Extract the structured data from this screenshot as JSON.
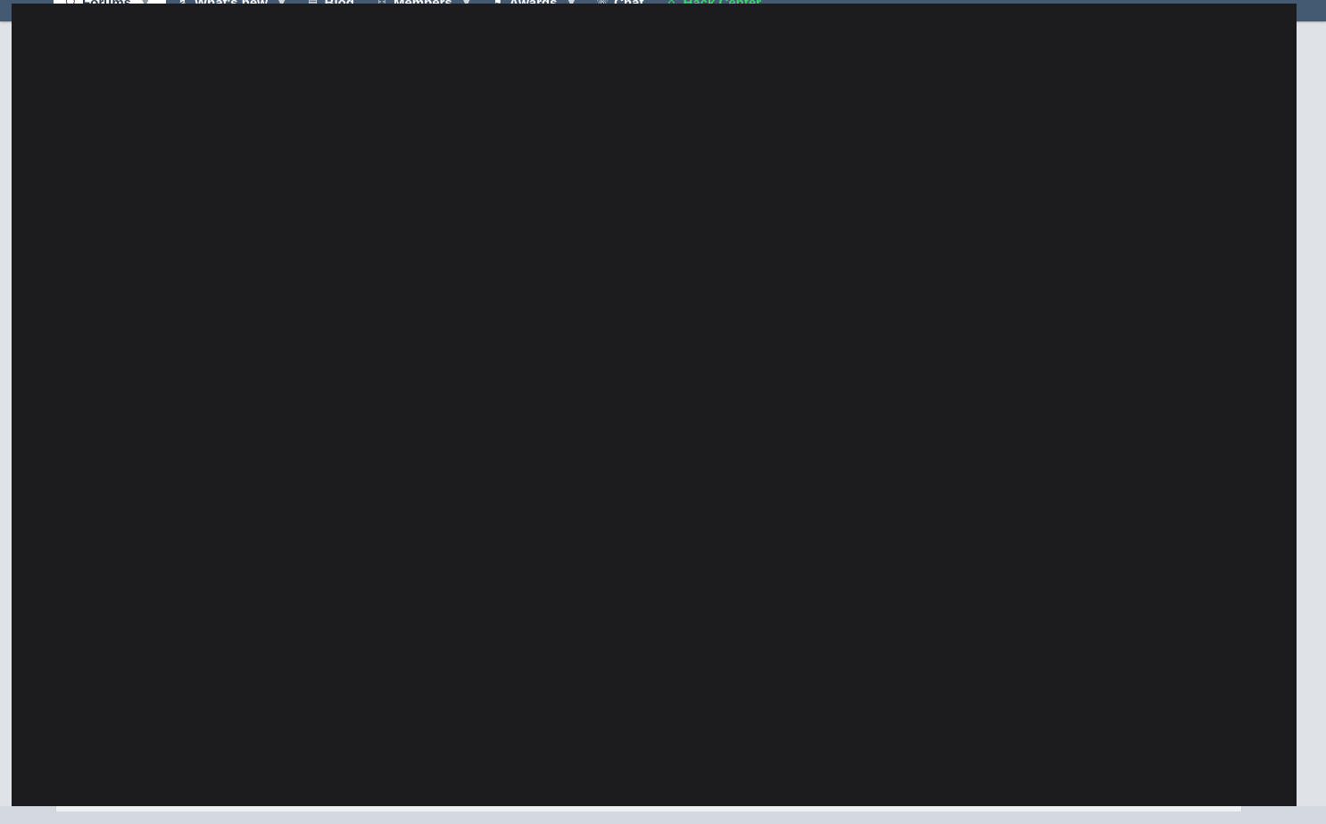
{
  "nav": {
    "items": [
      {
        "label": "Forums",
        "icon": "chat-bubble-icon",
        "glyph": "🗨",
        "has_dropdown": true,
        "active": true
      },
      {
        "label": "What's new",
        "icon": "whats-new-icon",
        "glyph": "↯",
        "has_dropdown": true,
        "active": false
      },
      {
        "label": "Blog",
        "icon": "newspaper-icon",
        "glyph": "▤",
        "has_dropdown": false,
        "active": false
      },
      {
        "label": "Members",
        "icon": "users-icon",
        "glyph": "⚇",
        "has_dropdown": true,
        "active": false
      },
      {
        "label": "Awards",
        "icon": "award-icon",
        "glyph": "⚑",
        "has_dropdown": true,
        "active": false
      },
      {
        "label": "Chat",
        "icon": "chat-icon",
        "glyph": "☏",
        "has_dropdown": false,
        "active": false
      },
      {
        "label": "Hack Center",
        "icon": "hack-center-icon",
        "glyph": "⌂",
        "has_dropdown": false,
        "active": false
      }
    ]
  },
  "colors": {
    "topbar": "#445a73",
    "overlay": "#1c1c1e",
    "accent_green": "#3fd36d",
    "page_bg": "#dfe3e8"
  }
}
